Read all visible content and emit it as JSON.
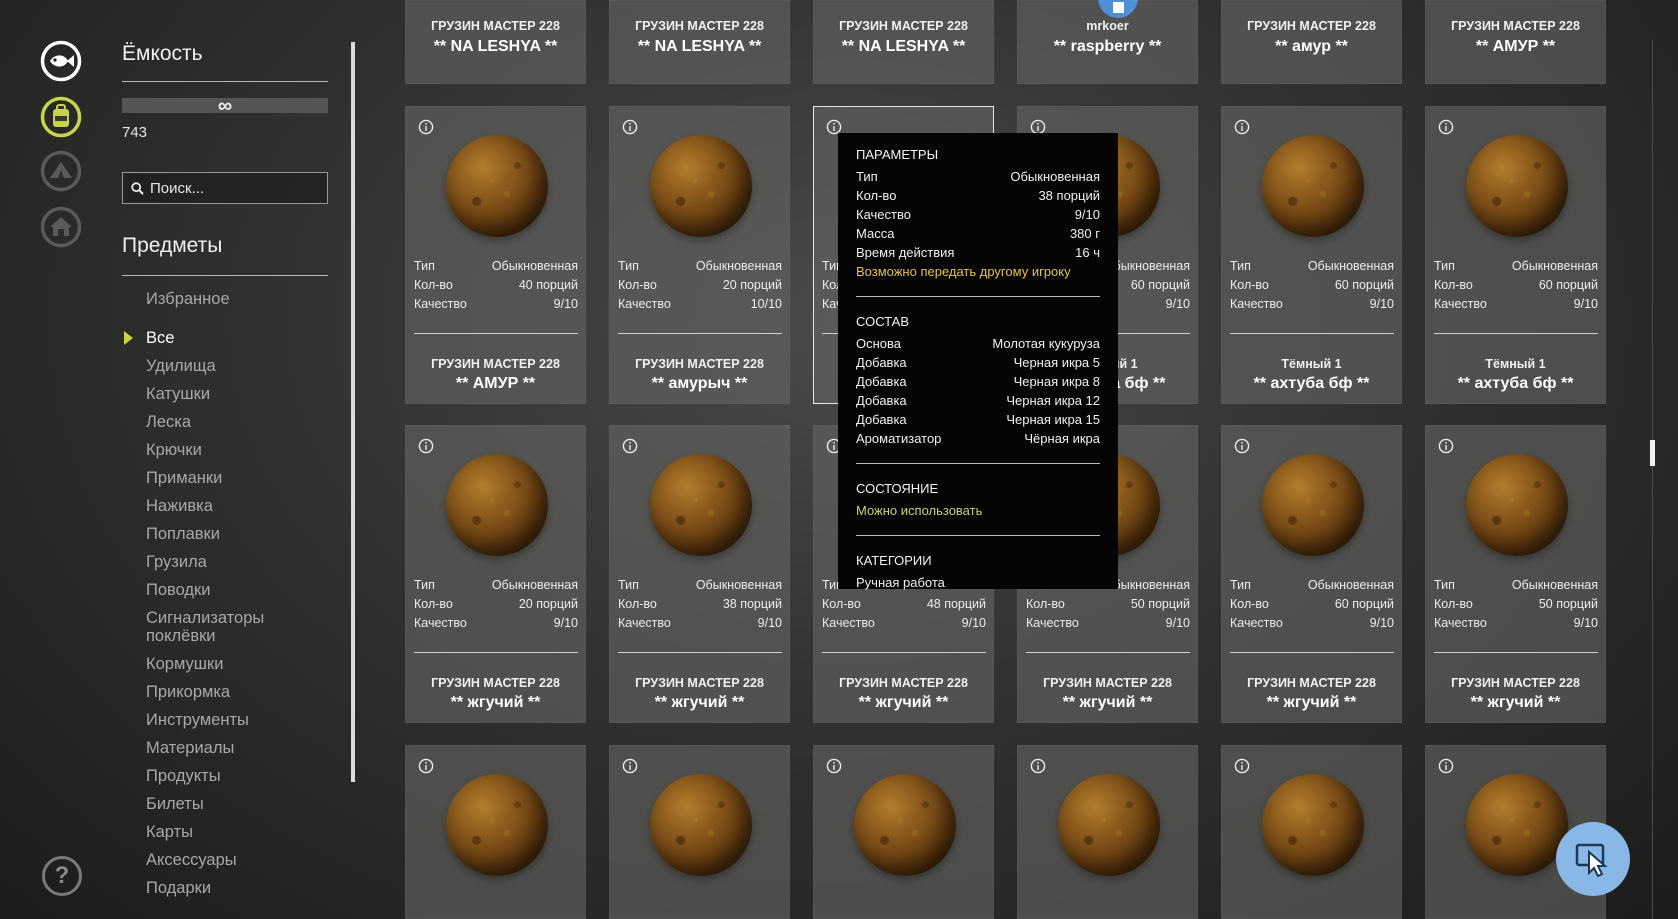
{
  "sidebar": {
    "title": "Ёмкость",
    "capacity_symbol": "∞",
    "item_count": "743",
    "search_placeholder": "Поиск...",
    "section_title": "Предметы",
    "categories": [
      {
        "label": "Избранное",
        "active": false
      },
      {
        "label": "Все",
        "active": true
      },
      {
        "label": "Удилища",
        "active": false
      },
      {
        "label": "Катушки",
        "active": false
      },
      {
        "label": "Леска",
        "active": false
      },
      {
        "label": "Крючки",
        "active": false
      },
      {
        "label": "Приманки",
        "active": false
      },
      {
        "label": "Наживка",
        "active": false
      },
      {
        "label": "Поплавки",
        "active": false
      },
      {
        "label": "Грузила",
        "active": false
      },
      {
        "label": "Поводки",
        "active": false
      },
      {
        "label": "Сигнализаторы поклёвки",
        "active": false
      },
      {
        "label": "Кормушки",
        "active": false
      },
      {
        "label": "Прикормка",
        "active": false
      },
      {
        "label": "Инструменты",
        "active": false
      },
      {
        "label": "Материалы",
        "active": false
      },
      {
        "label": "Продукты",
        "active": false
      },
      {
        "label": "Билеты",
        "active": false
      },
      {
        "label": "Карты",
        "active": false
      },
      {
        "label": "Аксессуары",
        "active": false
      },
      {
        "label": "Подарки",
        "active": false
      }
    ]
  },
  "rail": {
    "icons": [
      "fish-icon",
      "backpack-icon",
      "tent-icon",
      "home-icon"
    ],
    "help_label": "?"
  },
  "labels": {
    "type": "Тип",
    "qty": "Кол-во",
    "quality": "Качество"
  },
  "grid": {
    "top_row": [
      {
        "owner": "ГРУЗИН МАСТЕР 228",
        "bait": "** NA LESHYA **"
      },
      {
        "owner": "ГРУЗИН МАСТЕР 228",
        "bait": "** NA LESHYA **"
      },
      {
        "owner": "ГРУЗИН МАСТЕР 228",
        "bait": "** NA LESHYA **"
      },
      {
        "owner": "mrkoer",
        "bait": "** raspberry **"
      },
      {
        "owner": "ГРУЗИН МАСТЕР 228",
        "bait": "** амур **"
      },
      {
        "owner": "ГРУЗИН МАСТЕР 228",
        "bait": "** АМУР **"
      }
    ],
    "row2": [
      {
        "type": "Обыкновенная",
        "qty": "40 порций",
        "quality": "9/10",
        "owner": "ГРУЗИН МАСТЕР 228",
        "bait": "** АМУР **"
      },
      {
        "type": "Обыкновенная",
        "qty": "20 порций",
        "quality": "10/10",
        "owner": "ГРУЗИН МАСТЕР 228",
        "bait": "** амурыч **"
      },
      {
        "type": "Обыкновенная",
        "qty": "38 порций",
        "quality": "9/10",
        "owner": "",
        "bait": ""
      },
      {
        "type": "Обыкновенная",
        "qty": "60 порций",
        "quality": "9/10",
        "owner": "Тёмный 1",
        "bait": "** ахтуба бф **"
      },
      {
        "type": "Обыкновенная",
        "qty": "60 порций",
        "quality": "9/10",
        "owner": "Тёмный 1",
        "bait": "** ахтуба бф **"
      },
      {
        "type": "Обыкновенная",
        "qty": "60 порций",
        "quality": "9/10",
        "owner": "Тёмный 1",
        "bait": "** ахтуба бф **"
      }
    ],
    "row3": [
      {
        "type": "Обыкновенная",
        "qty": "20 порций",
        "quality": "9/10",
        "owner": "ГРУЗИН МАСТЕР 228",
        "bait": "** жгучий **"
      },
      {
        "type": "Обыкновенная",
        "qty": "38 порций",
        "quality": "9/10",
        "owner": "ГРУЗИН МАСТЕР 228",
        "bait": "** жгучий **"
      },
      {
        "type": "Обыкновенная",
        "qty": "48 порций",
        "quality": "9/10",
        "owner": "ГРУЗИН МАСТЕР 228",
        "bait": "** жгучий **"
      },
      {
        "type": "Обыкновенная",
        "qty": "50 порций",
        "quality": "9/10",
        "owner": "ГРУЗИН МАСТЕР 228",
        "bait": "** жгучий **"
      },
      {
        "type": "Обыкновенная",
        "qty": "60 порций",
        "quality": "9/10",
        "owner": "ГРУЗИН МАСТЕР 228",
        "bait": "** жгучий **"
      },
      {
        "type": "Обыкновенная",
        "qty": "50 порций",
        "quality": "9/10",
        "owner": "ГРУЗИН МАСТЕР 228",
        "bait": "** жгучий **"
      }
    ]
  },
  "tooltip": {
    "params_title": "ПАРАМЕТРЫ",
    "params": [
      {
        "k": "Тип",
        "v": "Обыкновенная"
      },
      {
        "k": "Кол-во",
        "v": "38 порций"
      },
      {
        "k": "Качество",
        "v": "9/10"
      },
      {
        "k": "Масса",
        "v": "380 г"
      },
      {
        "k": "Время действия",
        "v": "16 ч"
      }
    ],
    "transfer_note": "Возможно передать другому игроку",
    "composition_title": "СОСТАВ",
    "composition": [
      {
        "k": "Основа",
        "v": "Молотая кукуруза"
      },
      {
        "k": "Добавка",
        "v": "Черная икра 5"
      },
      {
        "k": "Добавка",
        "v": "Черная икра 8"
      },
      {
        "k": "Добавка",
        "v": "Черная икра 12"
      },
      {
        "k": "Добавка",
        "v": "Черная икра 15"
      },
      {
        "k": "Ароматизатор",
        "v": "Чёрная икра"
      }
    ],
    "state_title": "СОСТОЯНИЕ",
    "state_value": "Можно использовать",
    "categories_title": "КАТЕГОРИИ",
    "categories_value": "Ручная работа"
  },
  "colors": {
    "accent": "#c7d54a",
    "fab": "#8ab8e6",
    "badge": "#4f8fd8",
    "transfer": "#e2c24a"
  }
}
